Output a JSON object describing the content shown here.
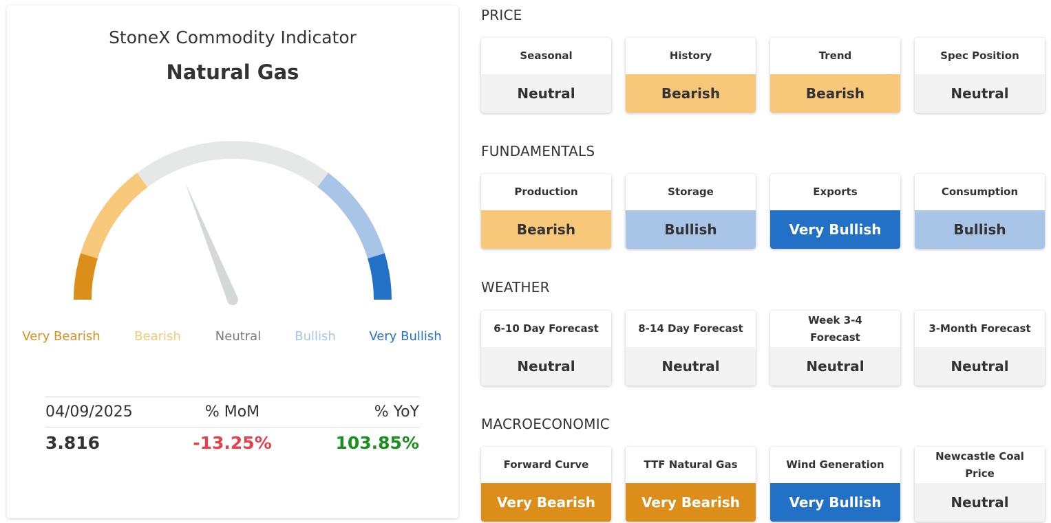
{
  "indicator": {
    "title": "StoneX Commodity Indicator",
    "commodity": "Natural Gas",
    "reading": "Neutral",
    "legend": [
      {
        "label": "Very Bearish",
        "color": "#db8e1a"
      },
      {
        "label": "Bearish",
        "color": "#f7c77a"
      },
      {
        "label": "Neutral",
        "color": "#7a7a7a"
      },
      {
        "label": "Bullish",
        "color": "#a8c5e8"
      },
      {
        "label": "Very Bullish",
        "color": "#2271c7"
      }
    ],
    "stats": {
      "headers": [
        "04/09/2025",
        "% MoM",
        "% YoY"
      ],
      "values": [
        "3.816",
        "-13.25%",
        "103.85%"
      ],
      "value_colors": [
        "#333333",
        "#e5414a",
        "#17901d"
      ]
    }
  },
  "rating_styles": {
    "Very Bearish": {
      "bg": "#db8e1a",
      "fg": "#ffffff"
    },
    "Bearish": {
      "bg": "#f7c77a",
      "fg": "#333333"
    },
    "Neutral": {
      "bg": "#f2f3f2",
      "fg": "#333333"
    },
    "Bullish": {
      "bg": "#a8c5e8",
      "fg": "#333333"
    },
    "Very Bullish": {
      "bg": "#2271c7",
      "fg": "#ffffff"
    }
  },
  "sections": [
    {
      "title": "PRICE",
      "items": [
        {
          "label": "Seasonal",
          "value": "Neutral"
        },
        {
          "label": "History",
          "value": "Bearish"
        },
        {
          "label": "Trend",
          "value": "Bearish"
        },
        {
          "label": "Spec Position",
          "value": "Neutral"
        }
      ]
    },
    {
      "title": "FUNDAMENTALS",
      "items": [
        {
          "label": "Production",
          "value": "Bearish"
        },
        {
          "label": "Storage",
          "value": "Bullish"
        },
        {
          "label": "Exports",
          "value": "Very Bullish"
        },
        {
          "label": "Consumption",
          "value": "Bullish"
        }
      ]
    },
    {
      "title": "WEATHER",
      "items": [
        {
          "label": "6-10 Day Forecast",
          "value": "Neutral"
        },
        {
          "label": "8-14 Day Forecast",
          "value": "Neutral"
        },
        {
          "label": "Week 3-4 Forecast",
          "value": "Neutral"
        },
        {
          "label": "3-Month Forecast",
          "value": "Neutral"
        }
      ]
    },
    {
      "title": "MACROECONOMIC",
      "items": [
        {
          "label": "Forward Curve",
          "value": "Very Bearish"
        },
        {
          "label": "TTF Natural Gas",
          "value": "Very Bearish"
        },
        {
          "label": "Wind Generation",
          "value": "Very Bullish"
        },
        {
          "label": "Newcastle Coal Price",
          "value": "Neutral"
        }
      ]
    }
  ]
}
